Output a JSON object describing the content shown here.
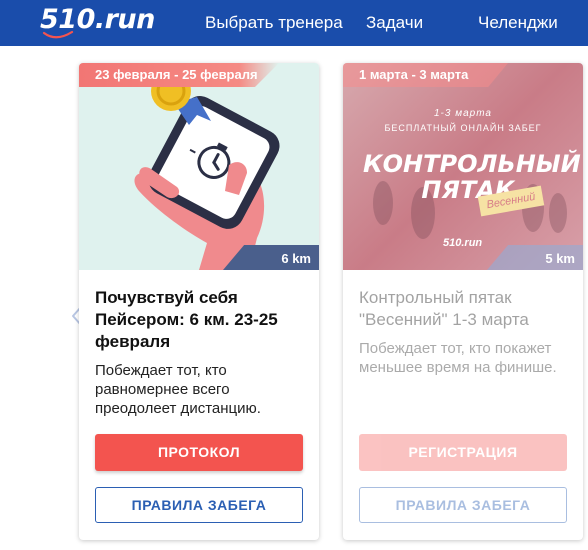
{
  "header": {
    "logo_text": "510.run",
    "nav": {
      "coach": "Выбрать тренера",
      "tasks": "Задачи",
      "challenges": "Челенджи"
    },
    "background_color": "#1a4dab"
  },
  "carousel": {
    "prev_icon": "chevron-left-icon"
  },
  "cards": [
    {
      "dates": "23 февраля - 25 февраля",
      "distance": "6 km",
      "title": "Почувствуй себя Пейсером: 6 км. 23-25 февраля",
      "description": "Побеждает тот, кто равномернее всего преодолеет дистанцию.",
      "primary_button": "ПРОТОКОЛ",
      "secondary_button": "ПРАВИЛА ЗАБЕГА",
      "image_icon": "phone-stopwatch-medal-icon"
    },
    {
      "dates": "1 марта - 3 марта",
      "distance": "5 km",
      "title": "Контрольный пятак \"Весенний\" 1-3 марта",
      "description": "Побеждает тот, кто покажет меньшее время на финише.",
      "primary_button": "РЕГИСТРАЦИЯ",
      "secondary_button": "ПРАВИЛА ЗАБЕГА",
      "poster": {
        "date": "1-3 марта",
        "subtitle": "БЕСПЛАТНЫЙ ОНЛАЙН ЗАБЕГ",
        "title": "КОНТРОЛЬНЫЙ ПЯТАК",
        "tag": "Весенний",
        "logo": "510.run"
      }
    }
  ],
  "colors": {
    "accent_red": "#f3544f",
    "accent_blue": "#2b5fb3"
  }
}
